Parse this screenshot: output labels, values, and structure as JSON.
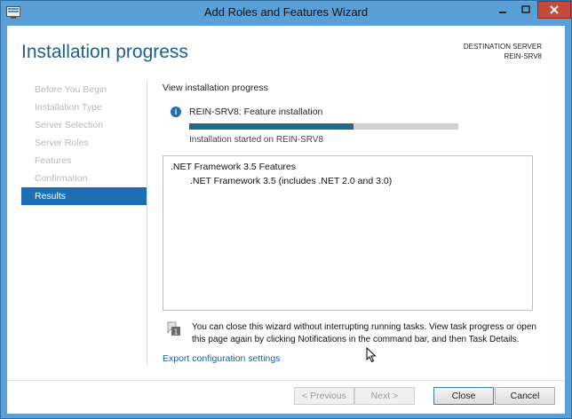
{
  "window": {
    "title": "Add Roles and Features Wizard"
  },
  "header": {
    "title": "Installation progress",
    "destination_label": "DESTINATION SERVER",
    "destination_server": "REIN-SRV8"
  },
  "sidebar": {
    "steps": [
      {
        "label": "Before You Begin",
        "active": false
      },
      {
        "label": "Installation Type",
        "active": false
      },
      {
        "label": "Server Selection",
        "active": false
      },
      {
        "label": "Server Roles",
        "active": false
      },
      {
        "label": "Features",
        "active": false
      },
      {
        "label": "Confirmation",
        "active": false
      },
      {
        "label": "Results",
        "active": true
      }
    ]
  },
  "main": {
    "section_label": "View installation progress",
    "feature_title": "REIN-SRV8: Feature installation",
    "progress_fraction": 0.61,
    "started_text": "Installation started on REIN-SRV8",
    "features": [
      ".NET Framework 3.5 Features",
      ".NET Framework 3.5 (includes .NET 2.0 and 3.0)"
    ],
    "notice": "You can close this wizard without interrupting running tasks. View task progress or open this page again by clicking Notifications in the command bar, and then Task Details.",
    "notice_icon_text": "1",
    "export_link": "Export configuration settings"
  },
  "footer": {
    "previous": "< Previous",
    "next": "Next >",
    "close": "Close",
    "cancel": "Cancel"
  },
  "colors": {
    "accent": "#1c6fb5",
    "progress": "#1c6e8a",
    "title_bar": "#5aa0d6",
    "close_button": "#c7493b"
  }
}
